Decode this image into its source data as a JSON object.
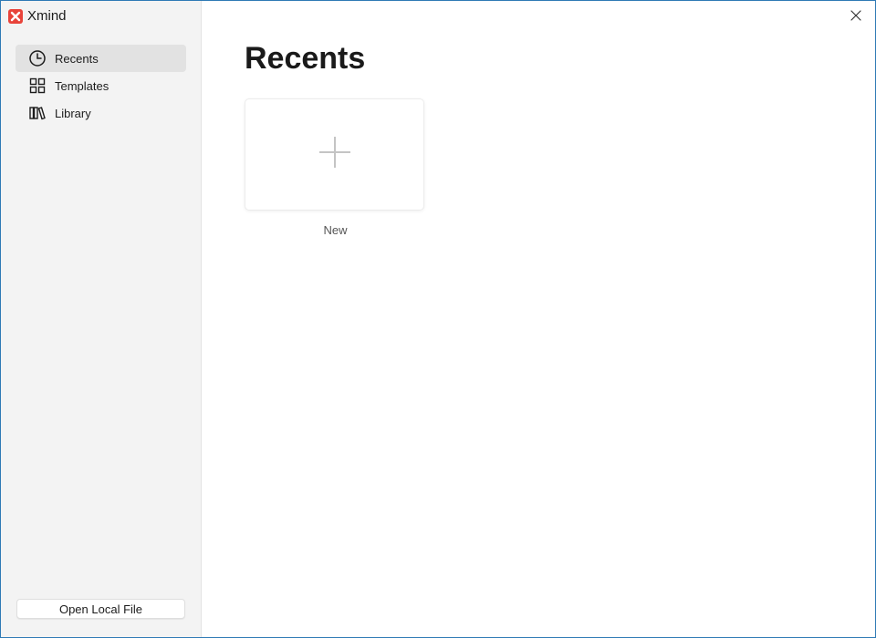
{
  "app": {
    "name": "Xmind",
    "brand_color": "#e8433a"
  },
  "sidebar": {
    "items": [
      {
        "label": "Recents",
        "icon": "clock-icon",
        "active": true
      },
      {
        "label": "Templates",
        "icon": "grid-icon",
        "active": false
      },
      {
        "label": "Library",
        "icon": "books-icon",
        "active": false
      }
    ],
    "open_local_file_label": "Open Local File"
  },
  "main": {
    "title": "Recents",
    "new_card": {
      "label": "New",
      "icon": "plus-icon"
    }
  },
  "window": {
    "close_icon": "close-icon"
  }
}
